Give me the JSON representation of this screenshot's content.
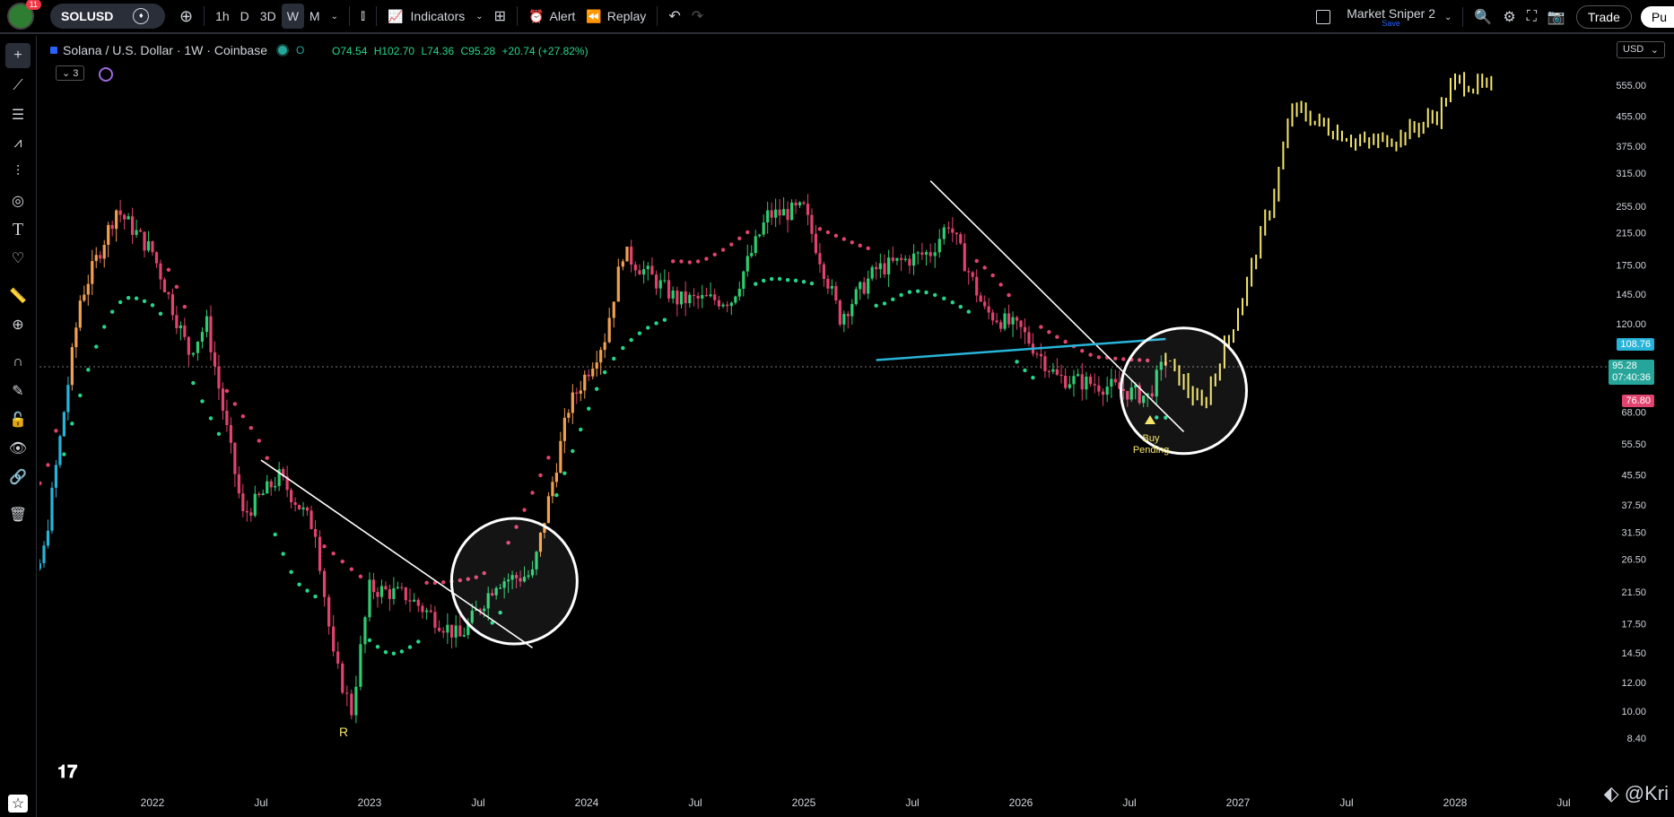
{
  "topbar": {
    "notifications": "11",
    "symbol": "SOLUSD",
    "timeframes": [
      "1h",
      "D",
      "3D",
      "W",
      "M"
    ],
    "active_timeframe": "W",
    "indicators_label": "Indicators",
    "alert_label": "Alert",
    "replay_label": "Replay",
    "layout_name": "Market Sniper 2",
    "save_label": "Save",
    "trade_label": "Trade",
    "publish_label": "Pu"
  },
  "legend": {
    "title": "Solana / U.S. Dollar · 1W · Coinbase",
    "open": "O74.54",
    "high": "H102.70",
    "low": "L74.36",
    "close": "C95.28",
    "change": "+20.74 (+27.82%)",
    "indicator_count": "3"
  },
  "currency": "USD",
  "price_tags": {
    "blue": "108.76",
    "green_price": "95.28",
    "green_time": "07:40:36",
    "red": "76.80"
  },
  "annotations": {
    "r_label": "R",
    "buy_label_1": "Buy",
    "buy_label_2": "Pending",
    "watermark": "@Kri"
  },
  "colors": {
    "up": "#2ecc71",
    "down": "#e0436e",
    "projection": "#f5e66b",
    "rising_early": "#f0a050",
    "blue_line": "#28b4d8",
    "dots_bull": "#26d68a",
    "dots_bear": "#e0436e"
  },
  "chart_data": {
    "type": "candlestick",
    "symbol": "SOLUSD",
    "timeframe": "1W",
    "y_scale": "log",
    "ylim": [
      7.5,
      640
    ],
    "y_ticks": [
      "555.00",
      "455.00",
      "375.00",
      "315.00",
      "255.00",
      "215.00",
      "175.00",
      "145.00",
      "120.00",
      "68.00",
      "55.50",
      "45.50",
      "37.50",
      "31.50",
      "26.50",
      "21.50",
      "17.50",
      "14.50",
      "12.00",
      "10.00",
      "8.40"
    ],
    "x_ticks": [
      "2022",
      "Jul",
      "2023",
      "Jul",
      "2024",
      "Jul",
      "2025",
      "Jul",
      "2026",
      "Jul",
      "2027",
      "Jul",
      "2028",
      "Jul"
    ],
    "current_price": 95.28,
    "price_path": [
      {
        "date": "2021-04",
        "price": 9
      },
      {
        "date": "2021-07",
        "price": 28
      },
      {
        "date": "2021-09",
        "price": 140
      },
      {
        "date": "2021-11",
        "price": 250
      },
      {
        "date": "2022-01",
        "price": 190
      },
      {
        "date": "2022-03",
        "price": 100
      },
      {
        "date": "2022-04",
        "price": 120
      },
      {
        "date": "2022-06",
        "price": 35
      },
      {
        "date": "2022-08",
        "price": 45
      },
      {
        "date": "2022-10",
        "price": 32
      },
      {
        "date": "2022-11",
        "price": 14
      },
      {
        "date": "2022-12",
        "price": 10
      },
      {
        "date": "2023-01",
        "price": 22
      },
      {
        "date": "2023-03",
        "price": 21
      },
      {
        "date": "2023-06",
        "price": 16
      },
      {
        "date": "2023-08",
        "price": 23
      },
      {
        "date": "2023-10",
        "price": 24
      },
      {
        "date": "2023-12",
        "price": 70
      },
      {
        "date": "2024-02",
        "price": 110
      },
      {
        "date": "2024-03",
        "price": 190
      },
      {
        "date": "2024-06",
        "price": 140
      },
      {
        "date": "2024-09",
        "price": 140
      },
      {
        "date": "2024-11",
        "price": 240
      },
      {
        "date": "2025-01",
        "price": 250
      },
      {
        "date": "2025-03",
        "price": 125
      },
      {
        "date": "2025-05",
        "price": 170
      },
      {
        "date": "2025-08",
        "price": 190
      },
      {
        "date": "2025-09",
        "price": 230
      },
      {
        "date": "2025-11",
        "price": 130
      },
      {
        "date": "2026-01",
        "price": 115
      },
      {
        "date": "2026-03",
        "price": 85
      },
      {
        "date": "2026-06",
        "price": 80
      },
      {
        "date": "2026-08",
        "price": 75
      },
      {
        "date": "2026-09",
        "price": 95
      }
    ],
    "projection_path": [
      {
        "date": "2026-09",
        "price": 95
      },
      {
        "date": "2026-11",
        "price": 70
      },
      {
        "date": "2026-12",
        "price": 95
      },
      {
        "date": "2027-01",
        "price": 130
      },
      {
        "date": "2027-02",
        "price": 190
      },
      {
        "date": "2027-03",
        "price": 280
      },
      {
        "date": "2027-04",
        "price": 480
      },
      {
        "date": "2027-06",
        "price": 420
      },
      {
        "date": "2027-08",
        "price": 380
      },
      {
        "date": "2027-10",
        "price": 400
      },
      {
        "date": "2027-12",
        "price": 460
      },
      {
        "date": "2028-01",
        "price": 570
      },
      {
        "date": "2028-03",
        "price": 540
      }
    ],
    "trend_lines": [
      {
        "from": {
          "date": "2022-07",
          "price": 50
        },
        "to": {
          "date": "2023-10",
          "price": 15
        }
      },
      {
        "from": {
          "date": "2025-08",
          "price": 300
        },
        "to": {
          "date": "2026-10",
          "price": 60
        }
      }
    ],
    "support_line": {
      "from": {
        "date": "2025-05",
        "price": 95
      },
      "to": {
        "date": "2026-09",
        "price": 108.76
      }
    },
    "circles": [
      {
        "center": {
          "date": "2023-09",
          "price": 23
        }
      },
      {
        "center": {
          "date": "2026-10",
          "price": 78
        }
      }
    ]
  }
}
